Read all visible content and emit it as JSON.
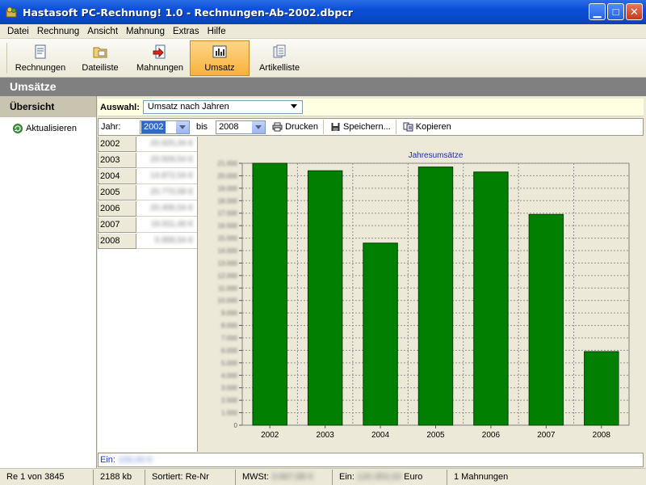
{
  "window": {
    "title": "Hastasoft PC-Rechnung! 1.0 - Rechnungen-Ab-2002.dbpcr"
  },
  "menu": [
    "Datei",
    "Rechnung",
    "Ansicht",
    "Mahnung",
    "Extras",
    "Hilfe"
  ],
  "toolbar": [
    {
      "label": "Rechnungen",
      "icon": "invoice-icon"
    },
    {
      "label": "Dateiliste",
      "icon": "folder-icon"
    },
    {
      "label": "Mahnungen",
      "icon": "reminder-icon"
    },
    {
      "label": "Umsatz",
      "icon": "chart-icon",
      "active": true
    },
    {
      "label": "Artikelliste",
      "icon": "article-list-icon"
    }
  ],
  "section_title": "Umsätze",
  "left_panel": {
    "header": "Übersicht",
    "refresh_label": "Aktualisieren"
  },
  "auswahl": {
    "label": "Auswahl:",
    "value": "Umsatz nach Jahren"
  },
  "filter": {
    "jahr_label": "Jahr:",
    "from_year": "2002",
    "bis_label": "bis",
    "to_year": "2008",
    "print_label": "Drucken",
    "save_label": "Speichern...",
    "copy_label": "Kopieren"
  },
  "table": {
    "rows": [
      {
        "year": "2002",
        "value": "20.925,34 €"
      },
      {
        "year": "2003",
        "value": "20.509,54 €"
      },
      {
        "year": "2004",
        "value": "14.872,54 €"
      },
      {
        "year": "2005",
        "value": "20.770,58 €"
      },
      {
        "year": "2006",
        "value": "20.406,54 €"
      },
      {
        "year": "2007",
        "value": "16.911,46 €"
      },
      {
        "year": "2008",
        "value": "5.958,54 €"
      }
    ]
  },
  "chart_data": {
    "type": "bar",
    "title": "Jahresumsätze",
    "categories": [
      "2002",
      "2003",
      "2004",
      "2005",
      "2006",
      "2007",
      "2008"
    ],
    "values": [
      21000,
      20400,
      14600,
      20700,
      20300,
      16900,
      5900
    ],
    "ylim": [
      0,
      21000
    ],
    "y_tick_step": 1000,
    "grid": true,
    "bar_color": "#007f00"
  },
  "ein_bar": {
    "label": "Ein:",
    "value": "100,00 €"
  },
  "status": {
    "record": "Re 1 von 3845",
    "size": "2188 kb",
    "sort": "Sortiert: Re-Nr",
    "mwst_label": "MWSt:",
    "mwst_value": "3.667,88 €",
    "ein_label": "Ein:",
    "ein_value": "120.353,33",
    "ein_unit": "Euro",
    "reminders": "1 Mahnungen"
  },
  "colors": {
    "title_blue": "#0b4fd8",
    "section_gray": "#808080",
    "active_orange": "#f7b23c",
    "bar_green": "#007f00"
  }
}
